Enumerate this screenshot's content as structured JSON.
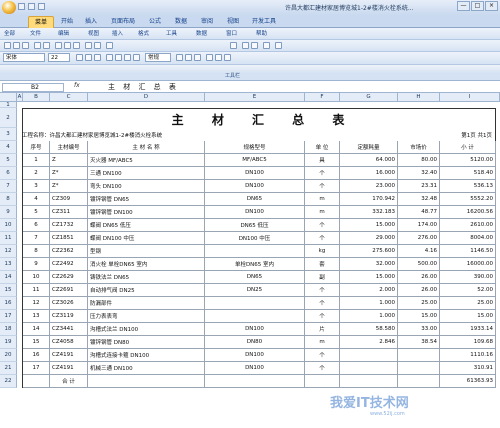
{
  "window": {
    "title": "许昌大都汇建材家居博览城1-2#楼消火栓系统...",
    "buttons": [
      "—",
      "□",
      "×"
    ]
  },
  "ribbon": {
    "tabs": [
      "开始",
      "插入",
      "页面布局",
      "公式",
      "数据",
      "审阅",
      "视图",
      "开发工具"
    ],
    "first_tab": "菜单",
    "active": "菜单"
  },
  "menus": [
    "全部",
    "文件",
    "编辑",
    "视图",
    "插入",
    "格式",
    "工具",
    "数据",
    "窗口",
    "帮助"
  ],
  "toolbar2": {
    "font": "宋体",
    "size": "22",
    "style": "常规"
  },
  "toolbar_group_label": "工具栏",
  "formula": {
    "cell": "B2",
    "fx": "fx",
    "content": "主 材 汇 总 表"
  },
  "columns": [
    "A",
    "B",
    "C",
    "D",
    "E",
    "F",
    "G",
    "H",
    "I"
  ],
  "rows": [
    "1",
    "2",
    "3",
    "4",
    "5",
    "6",
    "7",
    "8",
    "9",
    "10",
    "11",
    "12",
    "13",
    "14",
    "15",
    "16",
    "17",
    "18",
    "19",
    "20",
    "21",
    "22"
  ],
  "sheet": {
    "title": "主 材 汇 总 表",
    "project": "工程名称：许昌大都汇建材家居博览城1-2#楼消火栓系统",
    "page": "第1页 共1页",
    "headers": [
      "序号",
      "主材编号",
      "主 材 名 称",
      "规格型号",
      "单 位",
      "定额耗量",
      "市场价",
      "小 计"
    ],
    "items": [
      [
        "1",
        "Z",
        "灭火器 MF/ABC5",
        "MF/ABC5",
        "具",
        "64.000",
        "80.00",
        "5120.00"
      ],
      [
        "2",
        "Z*",
        "三通 DN100",
        "DN100",
        "个",
        "16.000",
        "32.40",
        "518.40"
      ],
      [
        "3",
        "Z*",
        "弯头 DN100",
        "DN100",
        "个",
        "23.000",
        "23.31",
        "536.13"
      ],
      [
        "4",
        "CZ309",
        "镀锌钢管 DN65",
        "DN65",
        "m",
        "170.942",
        "32.48",
        "5552.20"
      ],
      [
        "5",
        "CZ311",
        "镀锌钢管 DN100",
        "DN100",
        "m",
        "332.183",
        "48.77",
        "16200.56"
      ],
      [
        "6",
        "CZ1732",
        "蝶阀 DN65 低压",
        "DN65 低压",
        "个",
        "15.000",
        "174.00",
        "2610.00"
      ],
      [
        "7",
        "CZ1851",
        "蝶阀 DN100 中压",
        "DN100 中压",
        "个",
        "29.000",
        "276.00",
        "8004.00"
      ],
      [
        "8",
        "CZ2362",
        "型钢",
        "",
        "kg",
        "275.600",
        "4.16",
        "1146.50"
      ],
      [
        "9",
        "CZ2492",
        "消火栓 单栓DN65 室内",
        "单栓DN65 室内",
        "套",
        "32.000",
        "500.00",
        "16000.00"
      ],
      [
        "10",
        "CZ2629",
        "铸铁法兰 DN65",
        "DN65",
        "副",
        "15.000",
        "26.00",
        "390.00"
      ],
      [
        "11",
        "CZ2691",
        "自动排气阀 DN25",
        "DN25",
        "个",
        "2.000",
        "26.00",
        "52.00"
      ],
      [
        "12",
        "CZ3026",
        "防漏部件",
        "",
        "个",
        "1.000",
        "25.00",
        "25.00"
      ],
      [
        "13",
        "CZ3119",
        "压力表表弯",
        "",
        "个",
        "1.000",
        "15.00",
        "15.00"
      ],
      [
        "14",
        "CZ3441",
        "沟槽式法兰 DN100",
        "DN100",
        "片",
        "58.580",
        "33.00",
        "1933.14"
      ],
      [
        "15",
        "CZ4058",
        "镀锌钢管 DN80",
        "DN80",
        "m",
        "2.846",
        "38.54",
        "109.68"
      ],
      [
        "16",
        "CZ4191",
        "沟槽式连接卡箍 DN100",
        "DN100",
        "个",
        "",
        "",
        "1110.16"
      ],
      [
        "17",
        "CZ4191",
        "机械三通 DN100",
        "DN100",
        "个",
        "",
        "",
        "310.91"
      ]
    ],
    "total": {
      "label": "合 计",
      "value": "61363.93"
    }
  },
  "watermark": {
    "text": "我爱IT技术网",
    "sub": "www.52ij.com"
  }
}
